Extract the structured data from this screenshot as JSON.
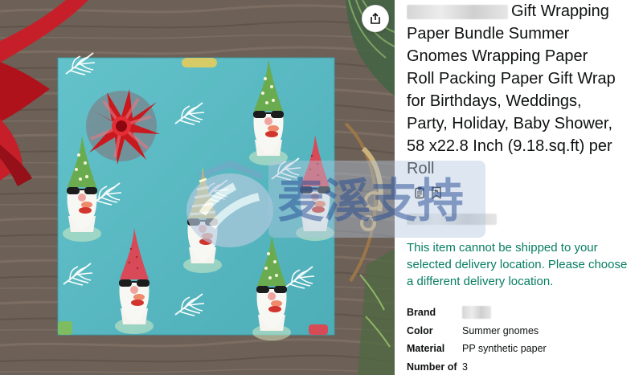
{
  "share": {
    "icon": "share-icon"
  },
  "product": {
    "title_lines": [
      "Gift Wrapping",
      "Paper Bundle Summer",
      "Gnomes Wrapping Paper",
      "Roll Packing Paper Gift Wrap",
      "for Birthdays, Weddings,",
      "Party, Holiday, Baby Shower,",
      "58 x22.8 Inch (9.18.sq.ft) per",
      "Roll"
    ],
    "shipping_message": "This item cannot be shipped to your selected delivery location. Please choose a different delivery location."
  },
  "actions": {
    "icons": [
      "clipboard-icon",
      "return-bookmark-icon"
    ]
  },
  "specs": [
    {
      "label": "Brand",
      "value": ""
    },
    {
      "label": "Color",
      "value": "Summer gnomes"
    },
    {
      "label": "Material",
      "value": "PP synthetic paper"
    },
    {
      "label": "Number of",
      "value": "3"
    }
  ],
  "watermark": {
    "text": "麦溪支持"
  },
  "colors": {
    "shipping_green": "#067d62",
    "wrapping_paper": "#58b8c3",
    "ribbon_red": "#c71f2a",
    "text": "#0f1111"
  }
}
